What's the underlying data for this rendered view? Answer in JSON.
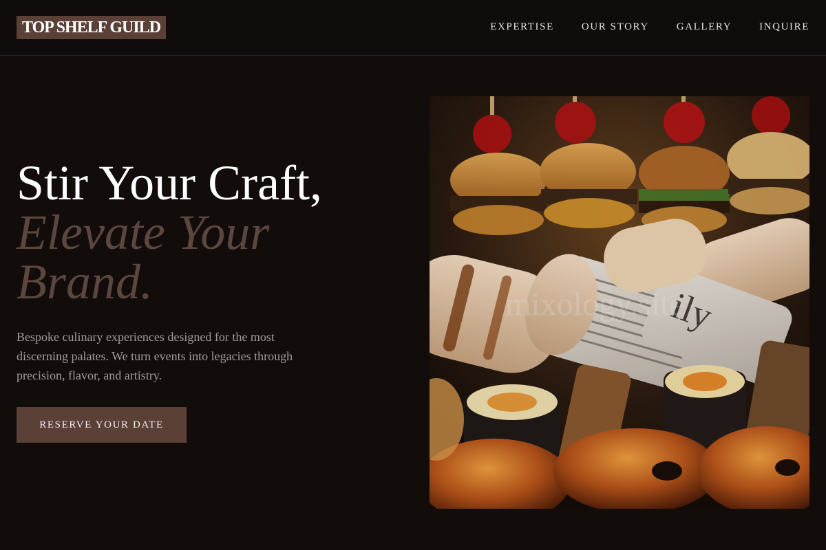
{
  "brand": {
    "name": "TOP SHELF GUILD"
  },
  "nav": {
    "items": [
      {
        "label": "EXPERTISE"
      },
      {
        "label": "OUR STORY"
      },
      {
        "label": "GALLERY"
      },
      {
        "label": "INQUIRE"
      }
    ]
  },
  "hero": {
    "headline_line1": "Stir Your Craft,",
    "headline_accent": "Elevate Your Brand.",
    "subtext": "Bespoke culinary experiences designed for the most discerning palates. We turn events into legacies through precision, flavor, and artistry.",
    "cta_label": "RESERVE YOUR DATE"
  },
  "image": {
    "subject": "catering appetizers: mini burgers, newspaper-wrapped tortilla rolls, sushi rolls, baked pastries",
    "watermark": "mixology.site"
  },
  "colors": {
    "background": "#120c0b",
    "topbar": "#0f0c0b",
    "accent": "#5b4038",
    "accent_text": "#5c4640",
    "body_text": "#a39c99"
  }
}
